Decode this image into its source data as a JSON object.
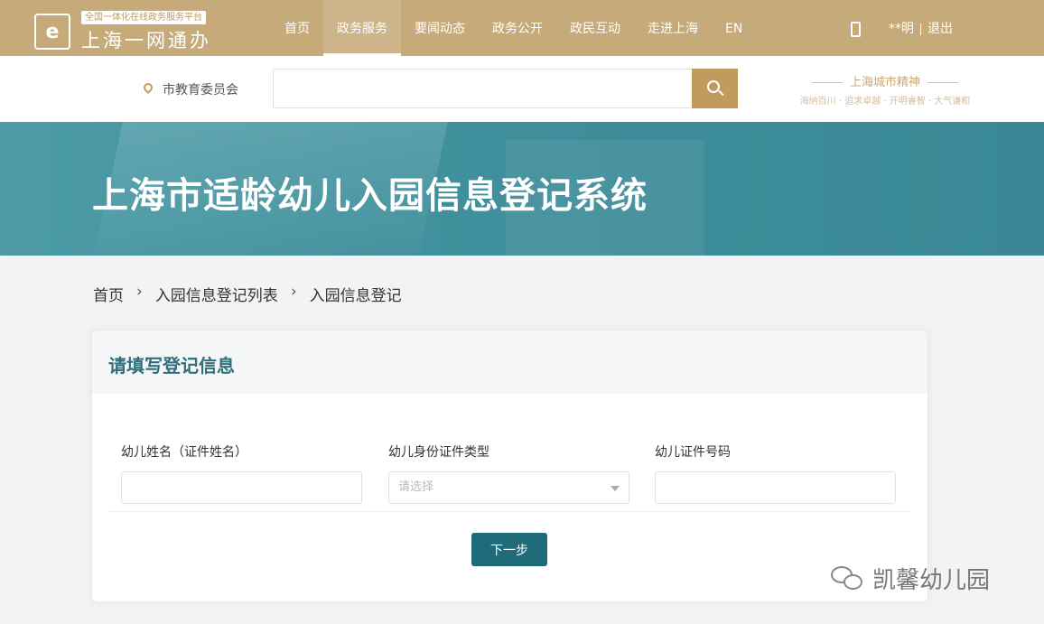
{
  "header": {
    "logo_mark": "e",
    "logo_tagline": "全国一体化在线政务服务平台",
    "logo_name": "上海一网通办",
    "nav": [
      "首页",
      "政务服务",
      "要闻动态",
      "政务公开",
      "政民互动",
      "走进上海",
      "EN"
    ],
    "active_nav": "政务服务",
    "user_name": "**明",
    "logout": "退出"
  },
  "search": {
    "location": "市教育委员会",
    "placeholder": "",
    "brand_title": "上海城市精神",
    "brand_subtitle": "海纳百川 · 追求卓越 · 开明睿智 · 大气谦和"
  },
  "banner": {
    "title": "上海市适龄幼儿入园信息登记系统"
  },
  "breadcrumb": [
    "首页",
    "入园信息登记列表",
    "入园信息登记"
  ],
  "form": {
    "title": "请填写登记信息",
    "fields": [
      {
        "label": "幼儿姓名（证件姓名）",
        "value": ""
      },
      {
        "label": "幼儿身份证件类型",
        "placeholder": "请选择"
      },
      {
        "label": "幼儿证件号码",
        "value": ""
      }
    ],
    "next_label": "下一步"
  },
  "watermark": {
    "text": "凯馨幼儿园"
  },
  "colors": {
    "header_bg": "#c7aa7a",
    "accent_gold": "#c19a5e",
    "banner_teal": "#3f8f9c",
    "button_teal": "#1f6b7a",
    "title_teal": "#2f6f7c"
  }
}
